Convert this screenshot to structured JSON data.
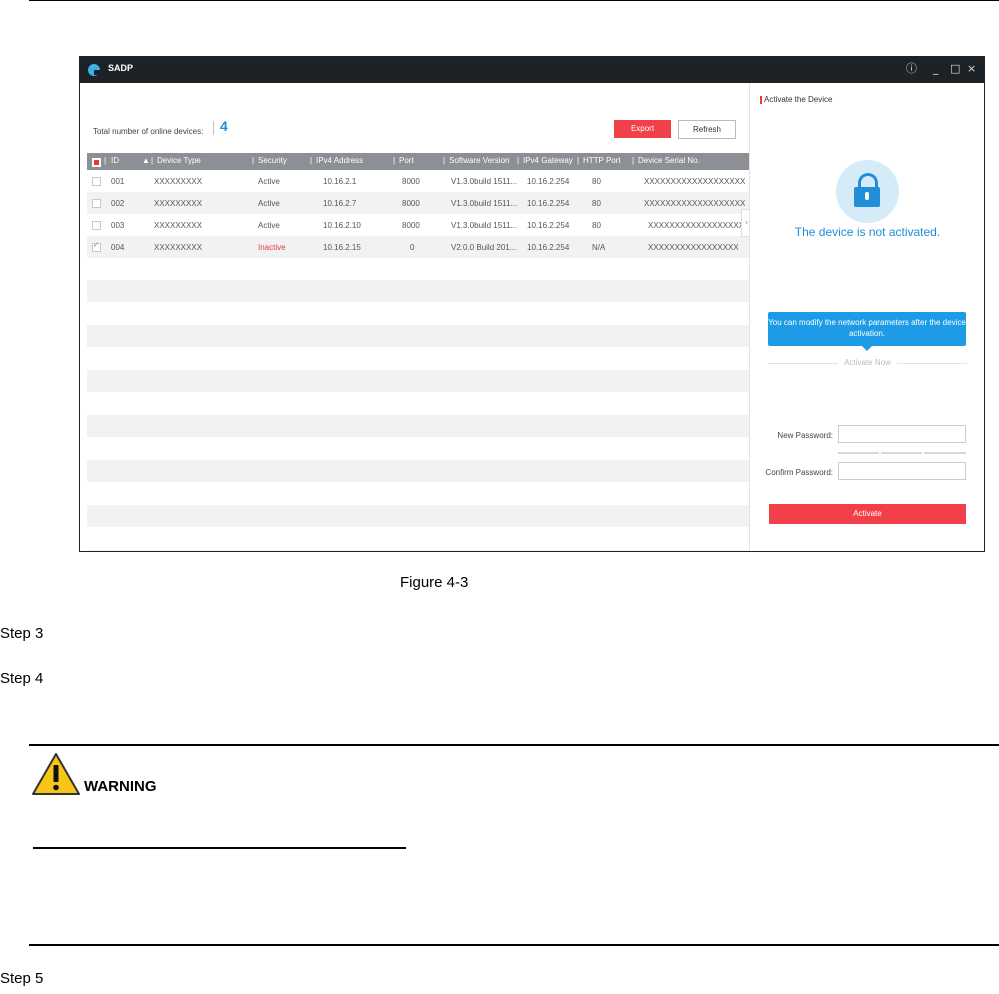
{
  "app": {
    "title": "SADP",
    "window_controls": {
      "info": "ⓘ",
      "minimize": "_",
      "maximize": "□",
      "close": "×"
    }
  },
  "toolbar": {
    "total_label": "Total number of online devices:",
    "total_count": "4",
    "export_label": "Export",
    "refresh_label": "Refresh"
  },
  "table": {
    "columns": [
      "ID",
      "Device Type",
      "Security",
      "IPv4 Address",
      "Port",
      "Software Version",
      "IPv4 Gateway",
      "HTTP Port",
      "Device Serial No."
    ],
    "rows": [
      {
        "checked": false,
        "id": "001",
        "device_type": "XXXXXXXXX",
        "security": "Active",
        "ipv4": "10.16.2.1",
        "port": "8000",
        "software": "V1.3.0build 1511...",
        "gateway": "10.16.2.254",
        "http_port": "80",
        "serial": "XXXXXXXXXXXXXXXXXXX"
      },
      {
        "checked": false,
        "id": "002",
        "device_type": "XXXXXXXXX",
        "security": "Active",
        "ipv4": "10.16.2.7",
        "port": "8000",
        "software": "V1.3.0build 1511...",
        "gateway": "10.16.2.254",
        "http_port": "80",
        "serial": "XXXXXXXXXXXXXXXXXXX"
      },
      {
        "checked": false,
        "id": "003",
        "device_type": "XXXXXXXXX",
        "security": "Active",
        "ipv4": "10.16.2.10",
        "port": "8000",
        "software": "V1.3.0build 1511...",
        "gateway": "10.16.2.254",
        "http_port": "80",
        "serial": "XXXXXXXXXXXXXXXXXX"
      },
      {
        "checked": true,
        "id": "004",
        "device_type": "XXXXXXXXX",
        "security": "Inactive",
        "ipv4": "10.16.2.15",
        "port": "0",
        "software": "V2.0.0 Build 201...",
        "gateway": "10.16.2.254",
        "http_port": "N/A",
        "serial": "XXXXXXXXXXXXXXXXX"
      }
    ]
  },
  "panel": {
    "title": "Activate the Device",
    "status": "The device is not activated.",
    "tip": "You can modify the network parameters after the device activation.",
    "activate_now": "Activate Now",
    "new_password_label": "New Password:",
    "confirm_password_label": "Confirm Password:",
    "activate_label": "Activate"
  },
  "document": {
    "caption": "Figure 4-3",
    "step3": "Step 3",
    "step4": "Step 4",
    "warning_label": "WARNING",
    "step5": "Step 5"
  },
  "colors": {
    "accent_red": "#f2404a",
    "accent_blue": "#1e8fd8",
    "titlebar": "#1d2227"
  }
}
